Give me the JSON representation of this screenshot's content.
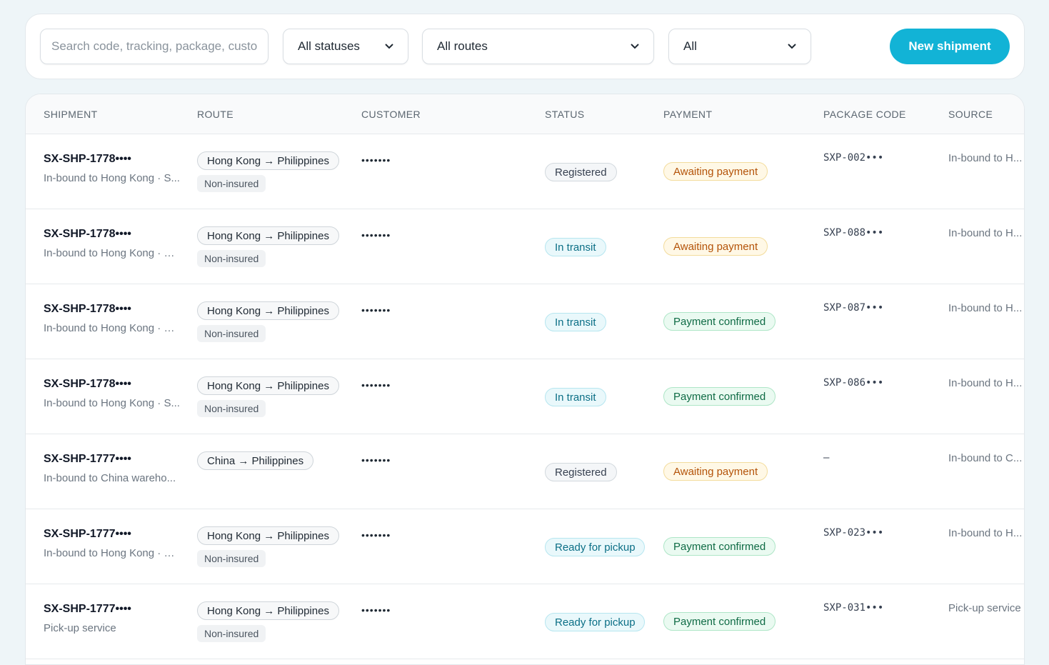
{
  "toolbar": {
    "search_placeholder": "Search code, tracking, package, customer",
    "status_filter": "All statuses",
    "route_filter": "All routes",
    "third_filter": "All",
    "new_button": "New shipment"
  },
  "table": {
    "headers": [
      "SHIPMENT",
      "ROUTE",
      "CUSTOMER",
      "STATUS",
      "PAYMENT",
      "PACKAGE CODE",
      "SOURCE"
    ],
    "rows": [
      {
        "code": "SX-SHP-1778••••",
        "sub": "In-bound to Hong Kong · S...",
        "route": "Hong Kong → Philippines",
        "insurance": "Non-insured",
        "customer": "•••••••",
        "status": "Registered",
        "status_kind": "registered",
        "payment": "Awaiting payment",
        "payment_kind": "await",
        "package": "SXP-002•••",
        "source": "In-bound to H..."
      },
      {
        "code": "SX-SHP-1778••••",
        "sub": "In-bound to Hong Kong · O...",
        "route": "Hong Kong → Philippines",
        "insurance": "Non-insured",
        "customer": "•••••••",
        "status": "In transit",
        "status_kind": "transit",
        "payment": "Awaiting payment",
        "payment_kind": "await",
        "package": "SXP-088•••",
        "source": "In-bound to H..."
      },
      {
        "code": "SX-SHP-1778••••",
        "sub": "In-bound to Hong Kong · O...",
        "route": "Hong Kong → Philippines",
        "insurance": "Non-insured",
        "customer": "•••••••",
        "status": "In transit",
        "status_kind": "transit",
        "payment": "Payment confirmed",
        "payment_kind": "ok",
        "package": "SXP-087•••",
        "source": "In-bound to H..."
      },
      {
        "code": "SX-SHP-1778••••",
        "sub": "In-bound to Hong Kong · S...",
        "route": "Hong Kong → Philippines",
        "insurance": "Non-insured",
        "customer": "•••••••",
        "status": "In transit",
        "status_kind": "transit",
        "payment": "Payment confirmed",
        "payment_kind": "ok",
        "package": "SXP-086•••",
        "source": "In-bound to H..."
      },
      {
        "code": "SX-SHP-1777••••",
        "sub": "In-bound to China wareho...",
        "route": "China → Philippines",
        "insurance": "",
        "customer": "•••••••",
        "status": "Registered",
        "status_kind": "registered",
        "payment": "Awaiting payment",
        "payment_kind": "await",
        "package": "–",
        "source": "In-bound to C..."
      },
      {
        "code": "SX-SHP-1777••••",
        "sub": "In-bound to Hong Kong · O...",
        "route": "Hong Kong → Philippines",
        "insurance": "Non-insured",
        "customer": "•••••••",
        "status": "Ready for pickup",
        "status_kind": "pickup",
        "payment": "Payment confirmed",
        "payment_kind": "ok",
        "package": "SXP-023•••",
        "source": "In-bound to H..."
      },
      {
        "code": "SX-SHP-1777••••",
        "sub": "Pick-up service",
        "route": "Hong Kong → Philippines",
        "insurance": "Non-insured",
        "customer": "•••••••",
        "status": "Ready for pickup",
        "status_kind": "pickup",
        "payment": "Payment confirmed",
        "payment_kind": "ok",
        "package": "SXP-031•••",
        "source": "Pick-up service"
      }
    ]
  },
  "colors": {
    "accent": "#12b3d6",
    "background": "#eef5f8"
  },
  "icons": {
    "dropdown": "chevron-down-icon"
  }
}
